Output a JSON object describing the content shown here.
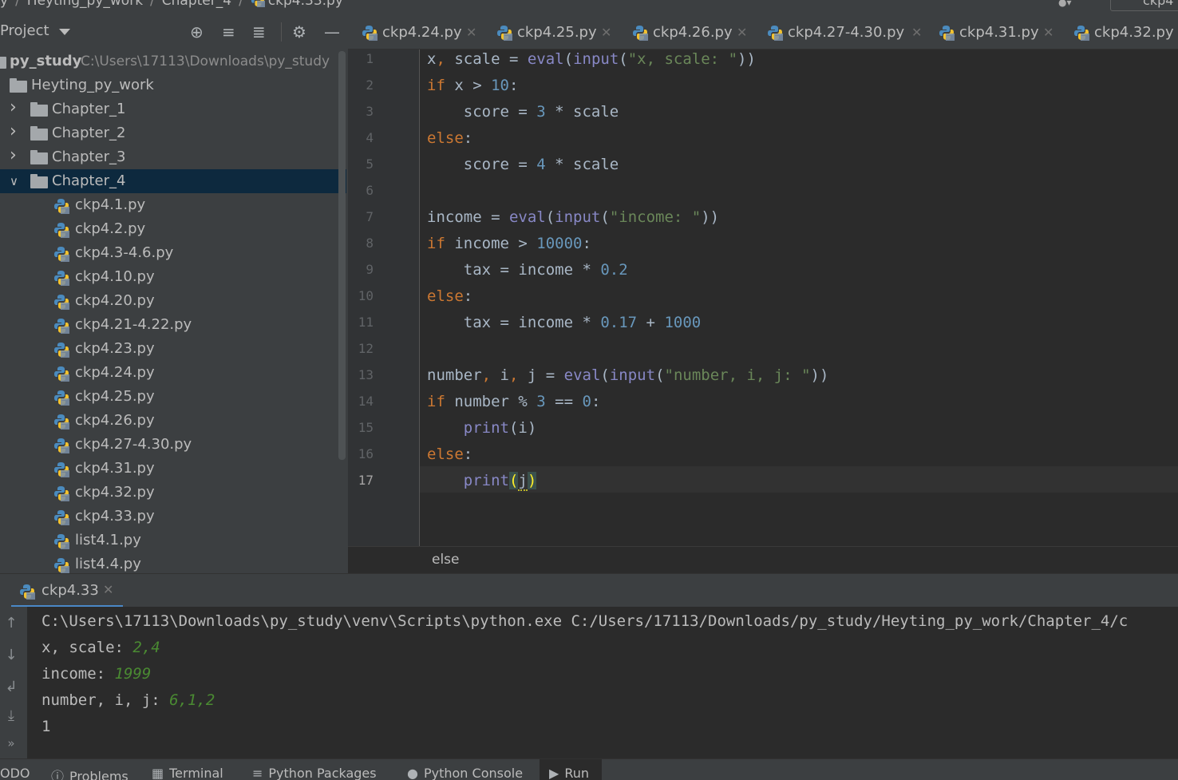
{
  "topbar": {
    "crumbs": [
      "y",
      "Heyting_py_work",
      "Chapter_4",
      "ckp4.33.py"
    ],
    "run_config": "ckp4"
  },
  "project": {
    "title": "Project",
    "root_name": "py_study",
    "root_path": "C:\\Users\\17113\\Downloads\\py_study",
    "work_folder": "Heyting_py_work",
    "folders": [
      "Chapter_1",
      "Chapter_2",
      "Chapter_3",
      "Chapter_4"
    ],
    "files": [
      "ckp4.1.py",
      "ckp4.2.py",
      "ckp4.3-4.6.py",
      "ckp4.10.py",
      "ckp4.20.py",
      "ckp4.21-4.22.py",
      "ckp4.23.py",
      "ckp4.24.py",
      "ckp4.25.py",
      "ckp4.26.py",
      "ckp4.27-4.30.py",
      "ckp4.31.py",
      "ckp4.32.py",
      "ckp4.33.py",
      "list4.1.py",
      "list4.4.py"
    ]
  },
  "editor_tabs": [
    "ckp4.24.py",
    "ckp4.25.py",
    "ckp4.26.py",
    "ckp4.27-4.30.py",
    "ckp4.31.py",
    "ckp4.32.py"
  ],
  "line_numbers": [
    "1",
    "2",
    "3",
    "4",
    "5",
    "6",
    "7",
    "8",
    "9",
    "10",
    "11",
    "12",
    "13",
    "14",
    "15",
    "16",
    "17"
  ],
  "code": {
    "l1": {
      "a": "x",
      "b": ", ",
      "c": "scale = ",
      "d": "eval",
      "e": "(",
      "f": "input",
      "g": "(",
      "h": "\"x, scale: \"",
      "i": "))"
    },
    "l2": {
      "a": "if",
      "b": " x > ",
      "c": "10",
      "d": ":"
    },
    "l3": {
      "a": "    score = ",
      "b": "3",
      "c": " * scale"
    },
    "l4": {
      "a": "else",
      "b": ":"
    },
    "l5": {
      "a": "    score = ",
      "b": "4",
      "c": " * scale"
    },
    "l7": {
      "a": "income = ",
      "b": "eval",
      "c": "(",
      "d": "input",
      "e": "(",
      "f": "\"income: \"",
      "g": "))"
    },
    "l8": {
      "a": "if",
      "b": " income > ",
      "c": "10000",
      "d": ":"
    },
    "l9": {
      "a": "    tax = income * ",
      "b": "0.2"
    },
    "l10": {
      "a": "else",
      "b": ":"
    },
    "l11": {
      "a": "    tax = income * ",
      "b": "0.17",
      "c": " + ",
      "d": "1000"
    },
    "l13": {
      "a": "number",
      "b": ", ",
      "c": "i",
      "d": ", ",
      "e": "j = ",
      "f": "eval",
      "g": "(",
      "h": "input",
      "i": "(",
      "j": "\"number, i, j: \"",
      "k": "))"
    },
    "l14": {
      "a": "if",
      "b": " number % ",
      "c": "3",
      "d": " == ",
      "e": "0",
      "f": ":"
    },
    "l15": {
      "a": "    ",
      "b": "print",
      "c": "(i)"
    },
    "l16": {
      "a": "else",
      "b": ":"
    },
    "l17": {
      "a": "    ",
      "b": "print",
      "c": "(",
      "d": "j",
      "e": ")"
    }
  },
  "editor_breadcrumb": "else",
  "run": {
    "tab_label": "ckp4.33",
    "command": "C:\\Users\\17113\\Downloads\\py_study\\venv\\Scripts\\python.exe C:/Users/17113/Downloads/py_study/Heyting_py_work/Chapter_4/c",
    "prompt1": "x, scale: ",
    "input1": "2,4",
    "prompt2": "income: ",
    "input2": "1999",
    "prompt3": "number, i, j: ",
    "input3": "6,1,2",
    "output": "1"
  },
  "toolwindows": [
    "ODO",
    "Problems",
    "Terminal",
    "Python Packages",
    "Python Console",
    "Run"
  ],
  "colors": {
    "keyword": "#cc7832",
    "number": "#6897bb",
    "string": "#6a8759",
    "builtin": "#8888c6",
    "selection": "#0d293e",
    "user_input": "#4a8a32"
  }
}
